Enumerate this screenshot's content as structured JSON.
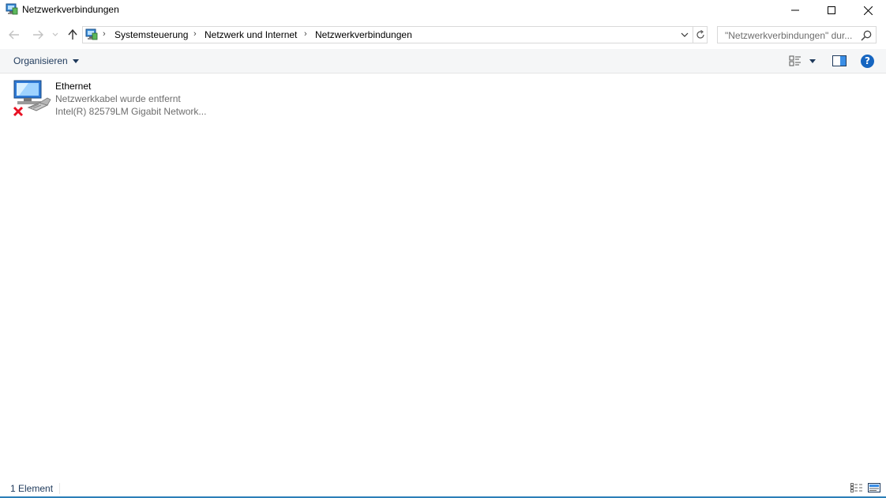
{
  "window": {
    "title": "Netzwerkverbindungen",
    "icon": "network-connections-icon",
    "controls": [
      "minimize-icon",
      "maximize-icon",
      "close-icon"
    ]
  },
  "navigation": {
    "back_icon": "arrow-left-icon",
    "forward_icon": "arrow-right-icon",
    "recent_icon": "chevron-down-icon",
    "up_icon": "arrow-up-icon"
  },
  "address": {
    "crumbs": [
      "Systemsteuerung",
      "Netzwerk und Internet",
      "Netzwerkverbindungen"
    ],
    "separator": "›",
    "refresh_icon": "refresh-icon"
  },
  "search": {
    "placeholder": "\"Netzwerkverbindungen\" dur...",
    "icon": "search-icon"
  },
  "toolbar": {
    "organize_label": "Organisieren",
    "view_icon": "change-view-icon",
    "preview_icon": "preview-pane-icon",
    "help_label": "?"
  },
  "items": [
    {
      "name": "Ethernet",
      "status": "Netzwerkkabel wurde entfernt",
      "device": "Intel(R) 82579LM Gigabit Network...",
      "icon": "ethernet-disconnected-icon"
    }
  ],
  "statusbar": {
    "count": "1 Element",
    "details_icon": "details-view-icon",
    "tiles_icon": "large-icons-view-icon"
  },
  "colors": {
    "accent": "#1e395b",
    "border": "#d9d9d9",
    "help": "#1565c0",
    "error": "#e81123"
  }
}
